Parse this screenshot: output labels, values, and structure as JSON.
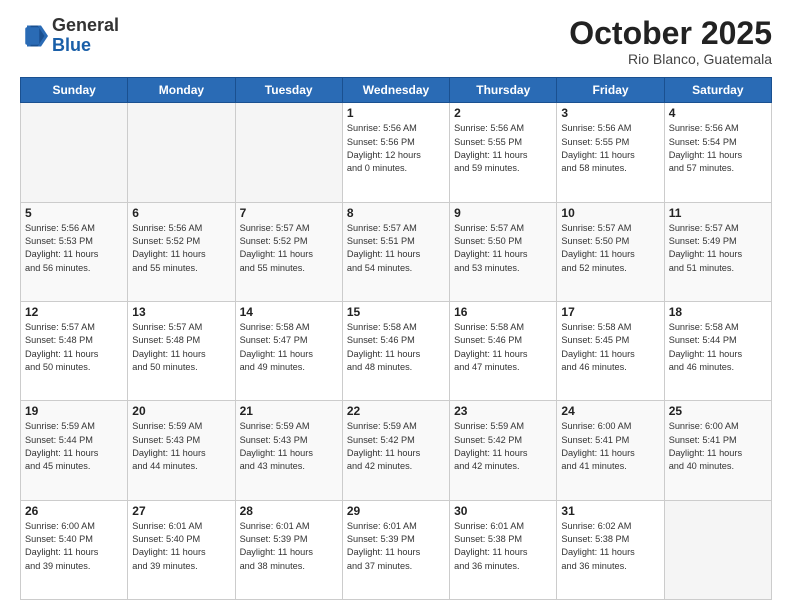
{
  "header": {
    "logo_general": "General",
    "logo_blue": "Blue",
    "month": "October 2025",
    "location": "Rio Blanco, Guatemala"
  },
  "days_of_week": [
    "Sunday",
    "Monday",
    "Tuesday",
    "Wednesday",
    "Thursday",
    "Friday",
    "Saturday"
  ],
  "weeks": [
    [
      {
        "day": "",
        "info": ""
      },
      {
        "day": "",
        "info": ""
      },
      {
        "day": "",
        "info": ""
      },
      {
        "day": "1",
        "info": "Sunrise: 5:56 AM\nSunset: 5:56 PM\nDaylight: 12 hours\nand 0 minutes."
      },
      {
        "day": "2",
        "info": "Sunrise: 5:56 AM\nSunset: 5:55 PM\nDaylight: 11 hours\nand 59 minutes."
      },
      {
        "day": "3",
        "info": "Sunrise: 5:56 AM\nSunset: 5:55 PM\nDaylight: 11 hours\nand 58 minutes."
      },
      {
        "day": "4",
        "info": "Sunrise: 5:56 AM\nSunset: 5:54 PM\nDaylight: 11 hours\nand 57 minutes."
      }
    ],
    [
      {
        "day": "5",
        "info": "Sunrise: 5:56 AM\nSunset: 5:53 PM\nDaylight: 11 hours\nand 56 minutes."
      },
      {
        "day": "6",
        "info": "Sunrise: 5:56 AM\nSunset: 5:52 PM\nDaylight: 11 hours\nand 55 minutes."
      },
      {
        "day": "7",
        "info": "Sunrise: 5:57 AM\nSunset: 5:52 PM\nDaylight: 11 hours\nand 55 minutes."
      },
      {
        "day": "8",
        "info": "Sunrise: 5:57 AM\nSunset: 5:51 PM\nDaylight: 11 hours\nand 54 minutes."
      },
      {
        "day": "9",
        "info": "Sunrise: 5:57 AM\nSunset: 5:50 PM\nDaylight: 11 hours\nand 53 minutes."
      },
      {
        "day": "10",
        "info": "Sunrise: 5:57 AM\nSunset: 5:50 PM\nDaylight: 11 hours\nand 52 minutes."
      },
      {
        "day": "11",
        "info": "Sunrise: 5:57 AM\nSunset: 5:49 PM\nDaylight: 11 hours\nand 51 minutes."
      }
    ],
    [
      {
        "day": "12",
        "info": "Sunrise: 5:57 AM\nSunset: 5:48 PM\nDaylight: 11 hours\nand 50 minutes."
      },
      {
        "day": "13",
        "info": "Sunrise: 5:57 AM\nSunset: 5:48 PM\nDaylight: 11 hours\nand 50 minutes."
      },
      {
        "day": "14",
        "info": "Sunrise: 5:58 AM\nSunset: 5:47 PM\nDaylight: 11 hours\nand 49 minutes."
      },
      {
        "day": "15",
        "info": "Sunrise: 5:58 AM\nSunset: 5:46 PM\nDaylight: 11 hours\nand 48 minutes."
      },
      {
        "day": "16",
        "info": "Sunrise: 5:58 AM\nSunset: 5:46 PM\nDaylight: 11 hours\nand 47 minutes."
      },
      {
        "day": "17",
        "info": "Sunrise: 5:58 AM\nSunset: 5:45 PM\nDaylight: 11 hours\nand 46 minutes."
      },
      {
        "day": "18",
        "info": "Sunrise: 5:58 AM\nSunset: 5:44 PM\nDaylight: 11 hours\nand 46 minutes."
      }
    ],
    [
      {
        "day": "19",
        "info": "Sunrise: 5:59 AM\nSunset: 5:44 PM\nDaylight: 11 hours\nand 45 minutes."
      },
      {
        "day": "20",
        "info": "Sunrise: 5:59 AM\nSunset: 5:43 PM\nDaylight: 11 hours\nand 44 minutes."
      },
      {
        "day": "21",
        "info": "Sunrise: 5:59 AM\nSunset: 5:43 PM\nDaylight: 11 hours\nand 43 minutes."
      },
      {
        "day": "22",
        "info": "Sunrise: 5:59 AM\nSunset: 5:42 PM\nDaylight: 11 hours\nand 42 minutes."
      },
      {
        "day": "23",
        "info": "Sunrise: 5:59 AM\nSunset: 5:42 PM\nDaylight: 11 hours\nand 42 minutes."
      },
      {
        "day": "24",
        "info": "Sunrise: 6:00 AM\nSunset: 5:41 PM\nDaylight: 11 hours\nand 41 minutes."
      },
      {
        "day": "25",
        "info": "Sunrise: 6:00 AM\nSunset: 5:41 PM\nDaylight: 11 hours\nand 40 minutes."
      }
    ],
    [
      {
        "day": "26",
        "info": "Sunrise: 6:00 AM\nSunset: 5:40 PM\nDaylight: 11 hours\nand 39 minutes."
      },
      {
        "day": "27",
        "info": "Sunrise: 6:01 AM\nSunset: 5:40 PM\nDaylight: 11 hours\nand 39 minutes."
      },
      {
        "day": "28",
        "info": "Sunrise: 6:01 AM\nSunset: 5:39 PM\nDaylight: 11 hours\nand 38 minutes."
      },
      {
        "day": "29",
        "info": "Sunrise: 6:01 AM\nSunset: 5:39 PM\nDaylight: 11 hours\nand 37 minutes."
      },
      {
        "day": "30",
        "info": "Sunrise: 6:01 AM\nSunset: 5:38 PM\nDaylight: 11 hours\nand 36 minutes."
      },
      {
        "day": "31",
        "info": "Sunrise: 6:02 AM\nSunset: 5:38 PM\nDaylight: 11 hours\nand 36 minutes."
      },
      {
        "day": "",
        "info": ""
      }
    ]
  ]
}
